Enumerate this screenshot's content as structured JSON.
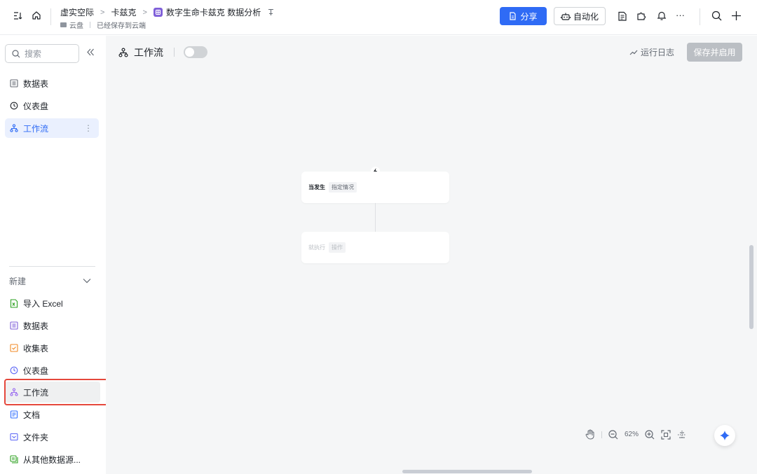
{
  "topbar": {
    "breadcrumb": [
      "虚实空际",
      "卡兹克"
    ],
    "doc_title": "数字生命卡兹克 数据分析",
    "location": "云盘",
    "save_status": "已经保存到云端",
    "share_label": "分享",
    "automation_label": "自动化",
    "more_label": "···"
  },
  "sidebar": {
    "search_placeholder": "搜索",
    "items": [
      {
        "label": "数据表",
        "icon": "table-icon"
      },
      {
        "label": "仪表盘",
        "icon": "dashboard-icon"
      },
      {
        "label": "工作流",
        "icon": "workflow-icon",
        "active": true
      }
    ],
    "item_more": "⋮",
    "new_section": {
      "title": "新建",
      "items": [
        {
          "label": "导入 Excel",
          "icon": "excel-icon",
          "color": "#2ea121"
        },
        {
          "label": "数据表",
          "icon": "table-icon",
          "color": "#7f5fd9"
        },
        {
          "label": "收集表",
          "icon": "form-icon",
          "color": "#f08a24"
        },
        {
          "label": "仪表盘",
          "icon": "dashboard-icon",
          "color": "#5b65f5"
        },
        {
          "label": "工作流",
          "icon": "workflow-icon",
          "color": "#9a6cf0",
          "highlighted": true
        },
        {
          "label": "文档",
          "icon": "doc-icon",
          "color": "#3370ff"
        },
        {
          "label": "文件夹",
          "icon": "folder-icon",
          "color": "#5b65f5"
        },
        {
          "label": "从其他数据源...",
          "icon": "datasource-icon",
          "color": "#2ea121"
        }
      ]
    }
  },
  "main": {
    "title": "工作流",
    "run_log_label": "运行日志",
    "save_enable_label": "保存并启用",
    "nodes": [
      {
        "label": "当发生",
        "tag": "指定情况"
      },
      {
        "label": "就执行",
        "tag": "操作"
      }
    ],
    "zoom_level": "62%"
  },
  "colors": {
    "accent": "#2f6bf5",
    "highlight_outline": "#e5483c"
  }
}
